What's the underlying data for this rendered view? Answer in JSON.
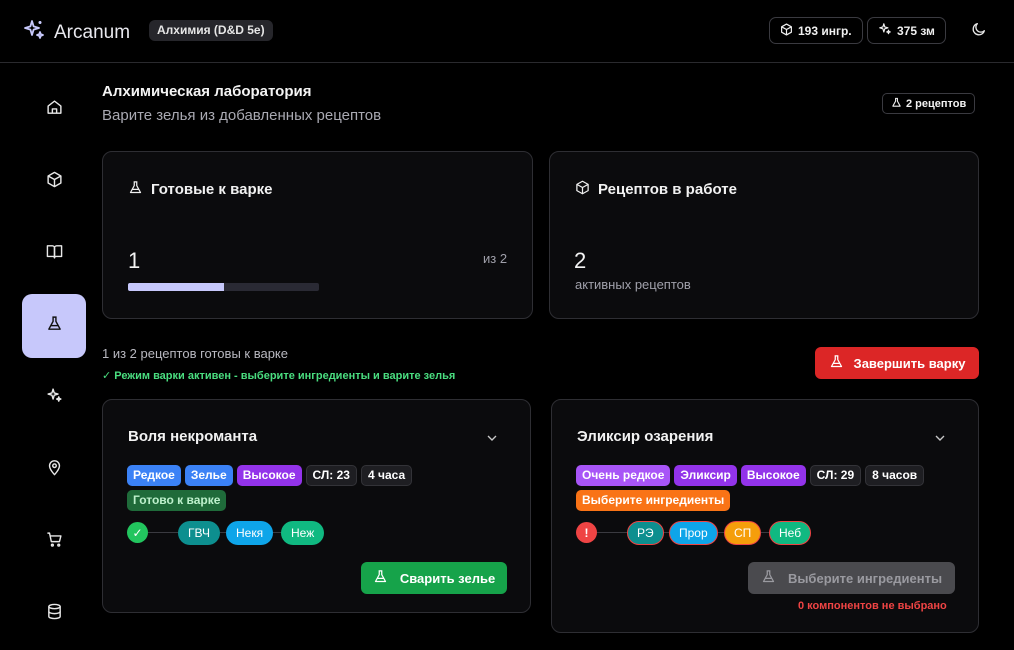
{
  "header": {
    "brand": "Arcanum",
    "campaign": "Алхимия (D&D 5e)",
    "ingredients": "193 ингр.",
    "gold": "375 зм"
  },
  "sidebar": {
    "items": [
      {
        "icon": "home-icon"
      },
      {
        "icon": "cube-icon"
      },
      {
        "icon": "book-icon"
      },
      {
        "icon": "flask-icon",
        "active": true
      },
      {
        "icon": "sparkles-icon"
      },
      {
        "icon": "map-pin-icon"
      },
      {
        "icon": "cart-icon"
      },
      {
        "icon": "database-icon"
      }
    ]
  },
  "page": {
    "title": "Алхимическая лаборатория",
    "subtitle": "Варите зелья из добавленных рецептов",
    "recipes_badge": "2 рецептов"
  },
  "stats": {
    "ready": {
      "title": "Готовые к варке",
      "value": "1",
      "of": "из 2",
      "progress": 0.5
    },
    "active": {
      "title": "Рецептов в работе",
      "value": "2",
      "sub": "активных рецептов"
    }
  },
  "status": {
    "line": "1 из 2 рецептов готовы к варке",
    "ok": "✓ Режим варки активен - выберите ингредиенты и варите зелья",
    "finish_button": "Завершить варку"
  },
  "recipes": [
    {
      "name": "Воля некроманта",
      "tags": [
        {
          "label": "Редкое",
          "color": "#3b82f6"
        },
        {
          "label": "Зелье",
          "color": "#3b82f6"
        },
        {
          "label": "Высокое",
          "color": "#9333ea"
        },
        {
          "label": "СЛ: 23",
          "color": "dark"
        },
        {
          "label": "4 часа",
          "color": "dark"
        }
      ],
      "state_tag": {
        "label": "Готово к варке",
        "color": "#1f6b3a"
      },
      "chain_status": "✓",
      "ingredients": [
        "ГВЧ",
        "Некя",
        "Неж"
      ],
      "button": "Сварить зелье"
    },
    {
      "name": "Эликсир озарения",
      "tags": [
        {
          "label": "Очень редкое",
          "color": "#a855f7"
        },
        {
          "label": "Эликсир",
          "color": "#9333ea"
        },
        {
          "label": "Высокое",
          "color": "#9333ea"
        },
        {
          "label": "СЛ: 29",
          "color": "dark"
        },
        {
          "label": "8 часов",
          "color": "dark"
        }
      ],
      "state_tag": {
        "label": "Выберите ингредиенты",
        "color": "#f97316"
      },
      "chain_status": "!",
      "ingredients": [
        "РЭ",
        "Прор",
        "СП",
        "Неб"
      ],
      "button": "Выберите ингредиенты",
      "warning": "0 компонентов не выбрано"
    }
  ]
}
